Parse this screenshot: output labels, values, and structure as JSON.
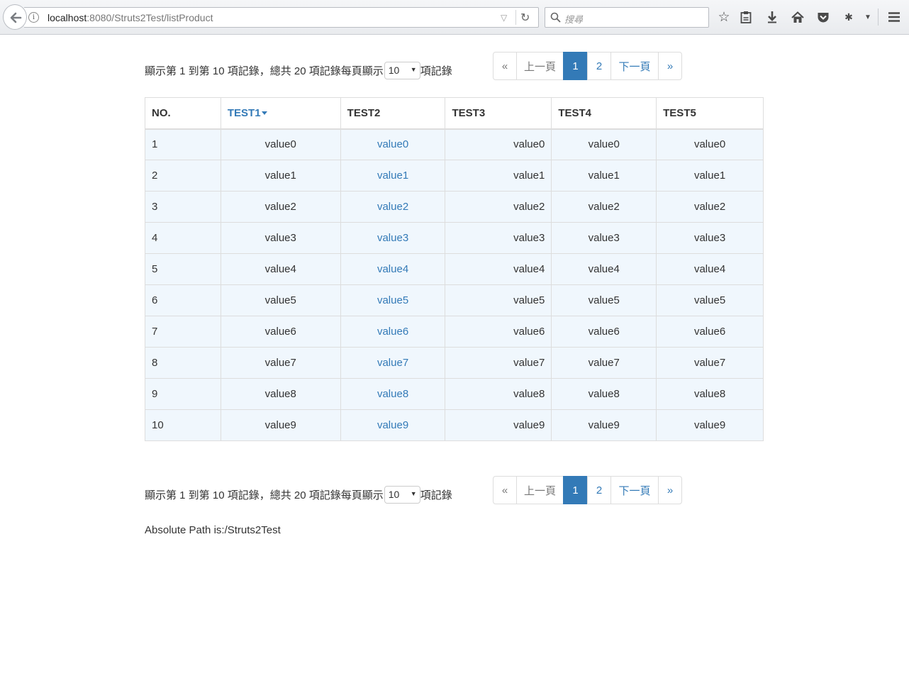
{
  "browser": {
    "url_host": "localhost",
    "url_rest": ":8080/Struts2Test/listProduct",
    "search_placeholder": "搜尋",
    "icons": [
      "back-arrow-icon",
      "info-icon",
      "dropdown-icon",
      "reload-icon",
      "search-icon",
      "bookmark-star-icon",
      "reading-list-icon",
      "download-icon",
      "home-icon",
      "pocket-icon",
      "extension-icon",
      "menu-icon"
    ]
  },
  "pager": {
    "info_prefix": "顯示第 1 到第 10 項記錄，總共 20 項記錄每頁顯示",
    "page_size": "10",
    "info_suffix": "項記錄",
    "buttons": [
      {
        "label": "«",
        "state": "disabled"
      },
      {
        "label": "上一頁",
        "state": "disabled"
      },
      {
        "label": "1",
        "state": "active"
      },
      {
        "label": "2",
        "state": "normal"
      },
      {
        "label": "下一頁",
        "state": "normal"
      },
      {
        "label": "»",
        "state": "normal"
      }
    ]
  },
  "table": {
    "headers": [
      "NO.",
      "TEST1",
      "TEST2",
      "TEST3",
      "TEST4",
      "TEST5"
    ],
    "sorted_column": "TEST1",
    "rows": [
      [
        "1",
        "value0",
        "value0",
        "value0",
        "value0",
        "value0"
      ],
      [
        "2",
        "value1",
        "value1",
        "value1",
        "value1",
        "value1"
      ],
      [
        "3",
        "value2",
        "value2",
        "value2",
        "value2",
        "value2"
      ],
      [
        "4",
        "value3",
        "value3",
        "value3",
        "value3",
        "value3"
      ],
      [
        "5",
        "value4",
        "value4",
        "value4",
        "value4",
        "value4"
      ],
      [
        "6",
        "value5",
        "value5",
        "value5",
        "value5",
        "value5"
      ],
      [
        "7",
        "value6",
        "value6",
        "value6",
        "value6",
        "value6"
      ],
      [
        "8",
        "value7",
        "value7",
        "value7",
        "value7",
        "value7"
      ],
      [
        "9",
        "value8",
        "value8",
        "value8",
        "value8",
        "value8"
      ],
      [
        "10",
        "value9",
        "value9",
        "value9",
        "value9",
        "value9"
      ]
    ]
  },
  "footer": {
    "absolute_path": "Absolute Path is:/Struts2Test"
  },
  "colors": {
    "link": "#337ab7",
    "row_bg": "#f0f7fd",
    "border": "#dddddd"
  }
}
